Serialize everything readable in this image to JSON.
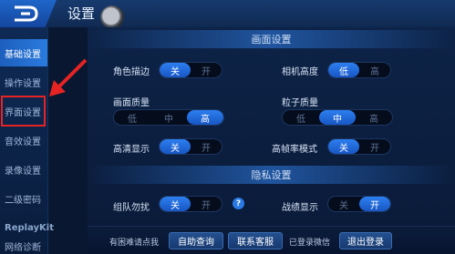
{
  "header": {
    "title": "设置",
    "back_icon": "back-arrow-icon"
  },
  "sidebar": {
    "items": [
      {
        "label": "基础设置",
        "active": true
      },
      {
        "label": "操作设置",
        "active": false
      },
      {
        "label": "界面设置",
        "active": false
      },
      {
        "label": "音效设置",
        "active": false
      },
      {
        "label": "录像设置",
        "active": false
      },
      {
        "label": "二级密码",
        "active": false
      },
      {
        "label": "ReplayKit",
        "active": false
      },
      {
        "label": "网络诊断",
        "active": false
      }
    ]
  },
  "annotation": {
    "color": "#e52323"
  },
  "display": {
    "section_title": "画面设置",
    "outline": {
      "label": "角色描边",
      "options": [
        "关",
        "开"
      ],
      "selected": "关"
    },
    "camera": {
      "label": "相机高度",
      "options": [
        "低",
        "高"
      ],
      "selected": "低"
    },
    "quality": {
      "label": "画面质量",
      "options": [
        "低",
        "中",
        "高"
      ],
      "selected": "高"
    },
    "particles": {
      "label": "粒子质量",
      "options": [
        "低",
        "中",
        "高"
      ],
      "selected": "中"
    },
    "hd": {
      "label": "高清显示",
      "options": [
        "关",
        "开"
      ],
      "selected": "关"
    },
    "highfps": {
      "label": "高帧率模式",
      "options": [
        "关",
        "开"
      ],
      "selected": "关"
    }
  },
  "privacy": {
    "section_title": "隐私设置",
    "dnd": {
      "label": "组队勿扰",
      "options": [
        "关",
        "开"
      ],
      "selected": "关"
    },
    "record": {
      "label": "战绩显示",
      "options": [
        "关",
        "开"
      ],
      "selected": "开"
    },
    "help_icon": "question-icon"
  },
  "footer": {
    "help_text": "有困难请点我",
    "self_help": "自助查询",
    "contact": "联系客服",
    "logged_in": "已登录微信",
    "logout": "退出登录"
  },
  "colors": {
    "accent": "#2d7ff0",
    "bg": "#0a1730",
    "sidebar_active": "#2a7bdf"
  }
}
